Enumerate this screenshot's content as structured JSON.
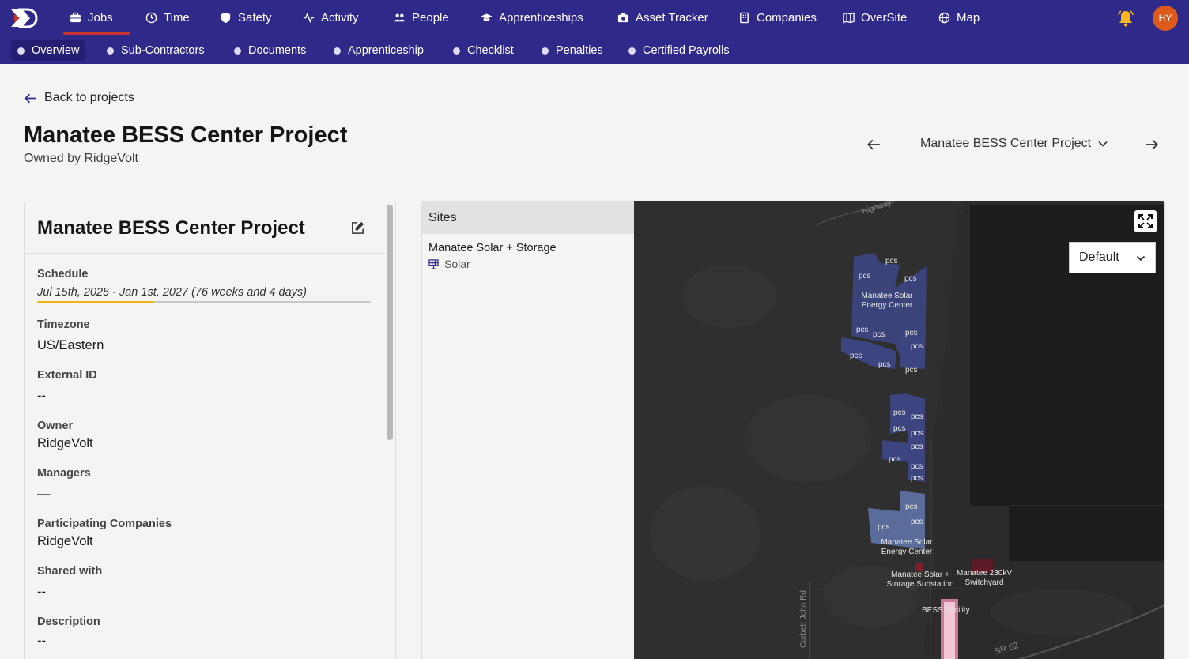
{
  "nav": {
    "items": [
      {
        "label": "Jobs",
        "icon": "briefcase-icon",
        "active": true
      },
      {
        "label": "Time",
        "icon": "clock-icon"
      },
      {
        "label": "Safety",
        "icon": "shield-icon"
      },
      {
        "label": "Activity",
        "icon": "activity-icon"
      },
      {
        "label": "People",
        "icon": "people-icon"
      },
      {
        "label": "Apprenticeships",
        "icon": "graduation-cap-icon"
      },
      {
        "label": "Asset Tracker",
        "icon": "camera-icon"
      },
      {
        "label": "Companies",
        "icon": "building-icon"
      },
      {
        "label": "OverSite",
        "icon": "map-fold-icon"
      },
      {
        "label": "Map",
        "icon": "globe-icon"
      }
    ],
    "avatar_initials": "HY"
  },
  "subnav": {
    "items": [
      {
        "label": "Overview",
        "active": true
      },
      {
        "label": "Sub-Contractors"
      },
      {
        "label": "Documents"
      },
      {
        "label": "Apprenticeship"
      },
      {
        "label": "Checklist"
      },
      {
        "label": "Penalties"
      },
      {
        "label": "Certified Payrolls"
      }
    ]
  },
  "header": {
    "back_label": "Back to projects",
    "title": "Manatee BESS Center Project",
    "owned_by": "Owned by RidgeVolt",
    "project_selector": "Manatee BESS Center Project"
  },
  "details": {
    "title": "Manatee BESS Center Project",
    "schedule_label": "Schedule",
    "schedule_value": "Jul 15th, 2025 - Jan 1st, 2027 (76 weeks and 4 days)",
    "schedule_progress": 0.35,
    "timezone_label": "Timezone",
    "timezone_value": "US/Eastern",
    "external_id_label": "External ID",
    "external_id_value": "--",
    "owner_label": "Owner",
    "owner_value": "RidgeVolt",
    "managers_label": "Managers",
    "managers_value": "—",
    "participating_label": "Participating Companies",
    "participating_value": "RidgeVolt",
    "shared_label": "Shared with",
    "shared_value": "--",
    "description_label": "Description",
    "description_value": "--"
  },
  "sites": {
    "header": "Sites",
    "items": [
      {
        "name": "Manatee Solar + Storage",
        "type": "Solar"
      }
    ]
  },
  "map": {
    "layer": "Default",
    "block_label": "pcs",
    "labels": {
      "energy_center_1": "Manatee Solar Energy Center",
      "energy_center_2": "Manatee Solar Energy Center",
      "substation": "Manatee Solar + Storage Substation",
      "switchyard": "Manatee 230kV Switchyard",
      "bess": "BESS Facility"
    },
    "roads": {
      "corbett": "Corbett John Rd",
      "sr62": "SR 62",
      "highway": "Highway"
    },
    "colors": {
      "background": "#2b2b2b",
      "block": "#3c4580",
      "block_light": "#5a6d9a",
      "bess": "#f2c7d6"
    }
  }
}
